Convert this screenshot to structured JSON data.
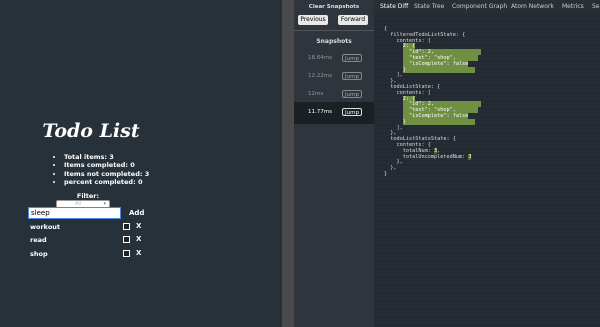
{
  "app": {
    "title": "Todo List",
    "stats": [
      "Total items: 3",
      "Items completed: 0",
      "Items not completed: 3",
      "percent completed: 0"
    ],
    "filter_label": "Filter:",
    "filter_value": "All",
    "new_item_value": "sleep",
    "add_label": "Add",
    "todos": [
      {
        "text": "workout",
        "completed": false
      },
      {
        "text": "read",
        "completed": false
      },
      {
        "text": "shop",
        "completed": false
      }
    ],
    "delete_label": "X"
  },
  "devtools": {
    "clear_label": "Clear Snapshots",
    "previous_label": "Previous",
    "forward_label": "Forward",
    "snapshots_title": "Snapshots",
    "jump_label": "Jump",
    "snapshots": [
      {
        "time": "18.64ms",
        "active": false
      },
      {
        "time": "12.22ms",
        "active": false
      },
      {
        "time": "12ms",
        "active": false
      },
      {
        "time": "11.77ms",
        "active": true
      }
    ],
    "tabs": [
      "State Diff",
      "State Tree",
      "Component Graph",
      "Atom Network",
      "Metrics",
      "Se"
    ],
    "active_tab": "State Diff",
    "code": {
      "l1": "{",
      "l2": "  filteredTodoListState: {",
      "l3": "    contents: [",
      "l4": "2: {",
      "l5": "  \"id\": 2,",
      "l6": "  \"text\": \"shop\",",
      "l7": "  \"isComplete\": false",
      "l8": "}",
      "l9": "    ],",
      "l10": "  },",
      "l11": "  todoListState: {",
      "l12": "    contents: [",
      "l13": "2: {",
      "l14": "  \"id\": 2,",
      "l15": "  \"text\": \"shop\",",
      "l16": "  \"isComplete\": false",
      "l17": "}",
      "l18": "    ],",
      "l19": "  },",
      "l20": "  todoListStatsState: {",
      "l21": "    contents: {",
      "l22": "      totalNum: ",
      "l22v": "3",
      "l22e": ",",
      "l23": "      totalUncompletedNum: ",
      "l23v": "3",
      "l24": "    },",
      "l25": "  },",
      "l26": "}"
    }
  }
}
